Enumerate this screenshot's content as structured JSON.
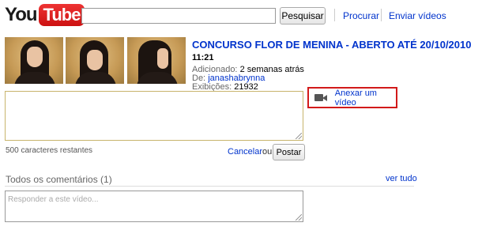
{
  "header": {
    "logo_you": "You",
    "logo_tube": "Tube",
    "search_value": "",
    "search_button": "Pesquisar",
    "nav": [
      "Procurar",
      "Enviar vídeos"
    ]
  },
  "video": {
    "title": "CONCURSO FLOR DE MENINA - ABERTO ATÉ 20/10/2010",
    "duration": "11:21",
    "added_label": "Adicionado:",
    "added_value": "2 semanas atrás",
    "by_label": "De:",
    "by_value": "janashabrynna",
    "views_label": "Exibições:",
    "views_value": "21932"
  },
  "comment_form": {
    "value": "",
    "attach_label": "Anexar um vídeo",
    "chars_left": "500 caracteres restantes",
    "cancel": "Cancelar",
    "or": "ou",
    "post": "Postar"
  },
  "comments": {
    "heading": "Todos os comentários (1)",
    "see_all": "ver tudo",
    "reply_placeholder": "Responder a este vídeo..."
  },
  "colors": {
    "link": "#0033cc",
    "logo_red": "#cc181e",
    "highlight_border": "#d21a1a",
    "comment_border": "#c8b46c"
  },
  "icons": [
    "video-camera-icon"
  ]
}
